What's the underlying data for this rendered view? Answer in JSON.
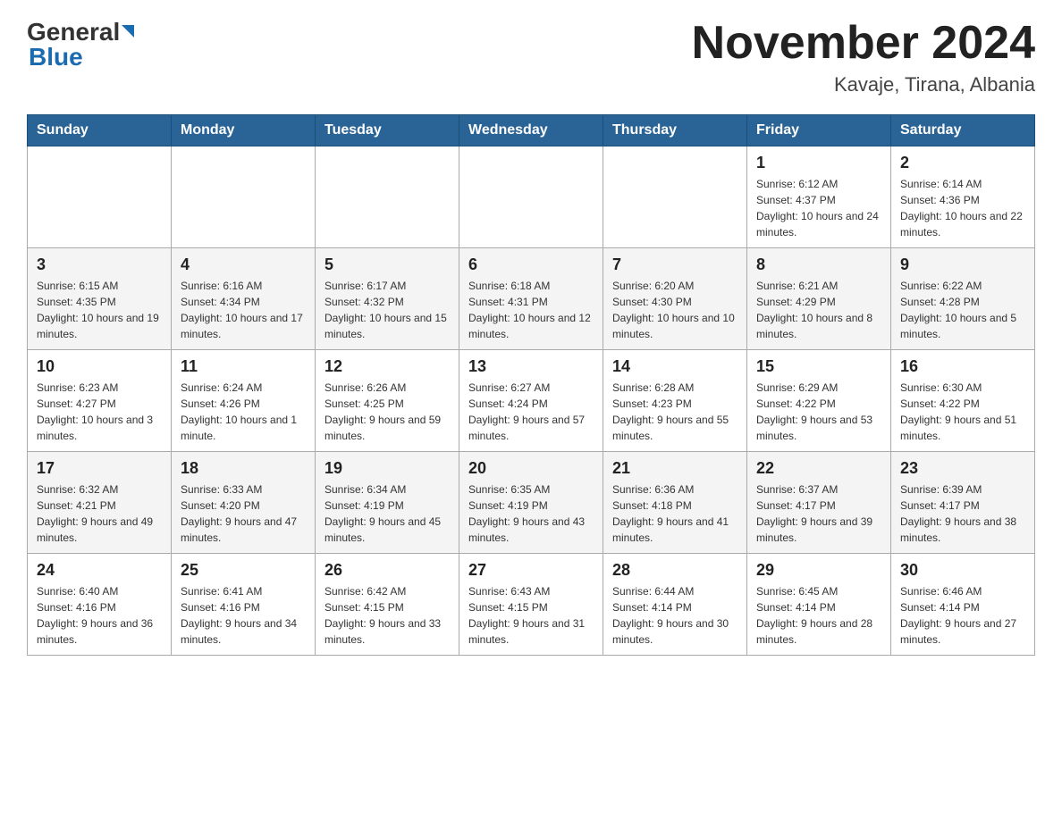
{
  "header": {
    "logo_general": "General",
    "logo_blue": "Blue",
    "month_title": "November 2024",
    "location": "Kavaje, Tirana, Albania"
  },
  "weekdays": [
    "Sunday",
    "Monday",
    "Tuesday",
    "Wednesday",
    "Thursday",
    "Friday",
    "Saturday"
  ],
  "rows": [
    {
      "cells": [
        {
          "day": "",
          "info": ""
        },
        {
          "day": "",
          "info": ""
        },
        {
          "day": "",
          "info": ""
        },
        {
          "day": "",
          "info": ""
        },
        {
          "day": "",
          "info": ""
        },
        {
          "day": "1",
          "info": "Sunrise: 6:12 AM\nSunset: 4:37 PM\nDaylight: 10 hours and 24 minutes."
        },
        {
          "day": "2",
          "info": "Sunrise: 6:14 AM\nSunset: 4:36 PM\nDaylight: 10 hours and 22 minutes."
        }
      ]
    },
    {
      "cells": [
        {
          "day": "3",
          "info": "Sunrise: 6:15 AM\nSunset: 4:35 PM\nDaylight: 10 hours and 19 minutes."
        },
        {
          "day": "4",
          "info": "Sunrise: 6:16 AM\nSunset: 4:34 PM\nDaylight: 10 hours and 17 minutes."
        },
        {
          "day": "5",
          "info": "Sunrise: 6:17 AM\nSunset: 4:32 PM\nDaylight: 10 hours and 15 minutes."
        },
        {
          "day": "6",
          "info": "Sunrise: 6:18 AM\nSunset: 4:31 PM\nDaylight: 10 hours and 12 minutes."
        },
        {
          "day": "7",
          "info": "Sunrise: 6:20 AM\nSunset: 4:30 PM\nDaylight: 10 hours and 10 minutes."
        },
        {
          "day": "8",
          "info": "Sunrise: 6:21 AM\nSunset: 4:29 PM\nDaylight: 10 hours and 8 minutes."
        },
        {
          "day": "9",
          "info": "Sunrise: 6:22 AM\nSunset: 4:28 PM\nDaylight: 10 hours and 5 minutes."
        }
      ]
    },
    {
      "cells": [
        {
          "day": "10",
          "info": "Sunrise: 6:23 AM\nSunset: 4:27 PM\nDaylight: 10 hours and 3 minutes."
        },
        {
          "day": "11",
          "info": "Sunrise: 6:24 AM\nSunset: 4:26 PM\nDaylight: 10 hours and 1 minute."
        },
        {
          "day": "12",
          "info": "Sunrise: 6:26 AM\nSunset: 4:25 PM\nDaylight: 9 hours and 59 minutes."
        },
        {
          "day": "13",
          "info": "Sunrise: 6:27 AM\nSunset: 4:24 PM\nDaylight: 9 hours and 57 minutes."
        },
        {
          "day": "14",
          "info": "Sunrise: 6:28 AM\nSunset: 4:23 PM\nDaylight: 9 hours and 55 minutes."
        },
        {
          "day": "15",
          "info": "Sunrise: 6:29 AM\nSunset: 4:22 PM\nDaylight: 9 hours and 53 minutes."
        },
        {
          "day": "16",
          "info": "Sunrise: 6:30 AM\nSunset: 4:22 PM\nDaylight: 9 hours and 51 minutes."
        }
      ]
    },
    {
      "cells": [
        {
          "day": "17",
          "info": "Sunrise: 6:32 AM\nSunset: 4:21 PM\nDaylight: 9 hours and 49 minutes."
        },
        {
          "day": "18",
          "info": "Sunrise: 6:33 AM\nSunset: 4:20 PM\nDaylight: 9 hours and 47 minutes."
        },
        {
          "day": "19",
          "info": "Sunrise: 6:34 AM\nSunset: 4:19 PM\nDaylight: 9 hours and 45 minutes."
        },
        {
          "day": "20",
          "info": "Sunrise: 6:35 AM\nSunset: 4:19 PM\nDaylight: 9 hours and 43 minutes."
        },
        {
          "day": "21",
          "info": "Sunrise: 6:36 AM\nSunset: 4:18 PM\nDaylight: 9 hours and 41 minutes."
        },
        {
          "day": "22",
          "info": "Sunrise: 6:37 AM\nSunset: 4:17 PM\nDaylight: 9 hours and 39 minutes."
        },
        {
          "day": "23",
          "info": "Sunrise: 6:39 AM\nSunset: 4:17 PM\nDaylight: 9 hours and 38 minutes."
        }
      ]
    },
    {
      "cells": [
        {
          "day": "24",
          "info": "Sunrise: 6:40 AM\nSunset: 4:16 PM\nDaylight: 9 hours and 36 minutes."
        },
        {
          "day": "25",
          "info": "Sunrise: 6:41 AM\nSunset: 4:16 PM\nDaylight: 9 hours and 34 minutes."
        },
        {
          "day": "26",
          "info": "Sunrise: 6:42 AM\nSunset: 4:15 PM\nDaylight: 9 hours and 33 minutes."
        },
        {
          "day": "27",
          "info": "Sunrise: 6:43 AM\nSunset: 4:15 PM\nDaylight: 9 hours and 31 minutes."
        },
        {
          "day": "28",
          "info": "Sunrise: 6:44 AM\nSunset: 4:14 PM\nDaylight: 9 hours and 30 minutes."
        },
        {
          "day": "29",
          "info": "Sunrise: 6:45 AM\nSunset: 4:14 PM\nDaylight: 9 hours and 28 minutes."
        },
        {
          "day": "30",
          "info": "Sunrise: 6:46 AM\nSunset: 4:14 PM\nDaylight: 9 hours and 27 minutes."
        }
      ]
    }
  ]
}
